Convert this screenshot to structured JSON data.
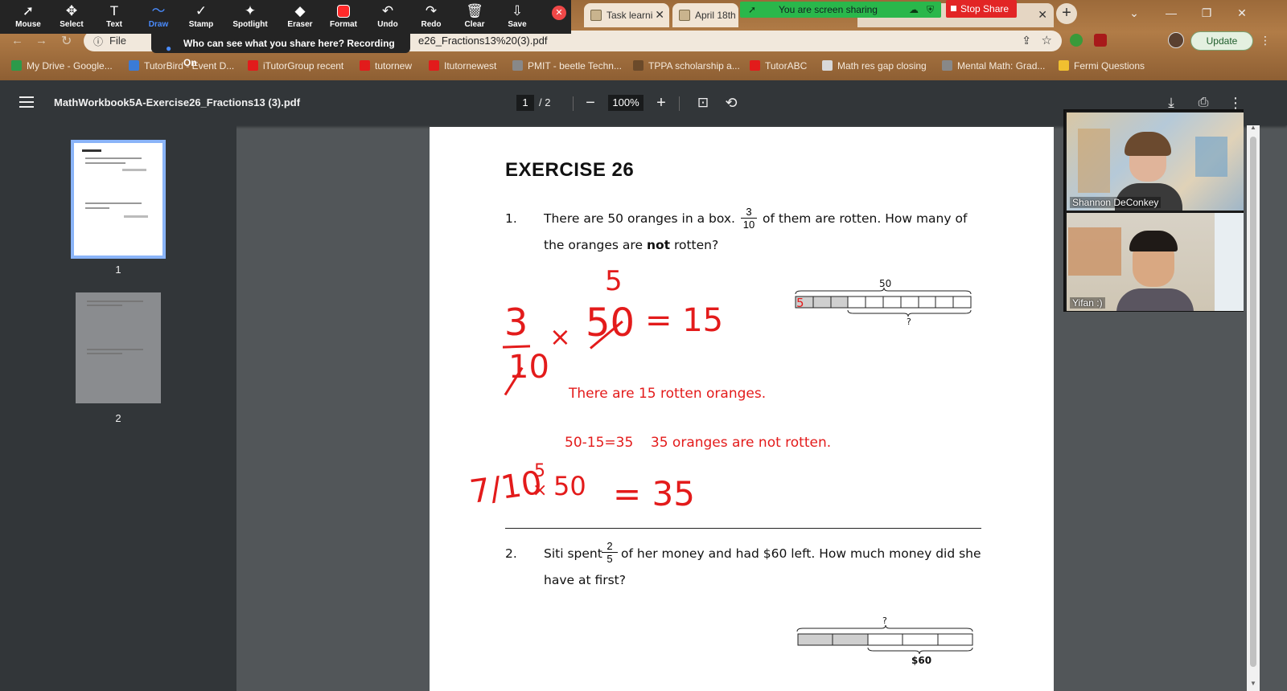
{
  "zoom_toolbar": {
    "tools": [
      {
        "label": "Mouse",
        "icon": "mouse-pointer-icon",
        "glyph": "➚"
      },
      {
        "label": "Select",
        "icon": "move-icon",
        "glyph": "✥"
      },
      {
        "label": "Text",
        "icon": "text-icon",
        "glyph": "T"
      },
      {
        "label": "Draw",
        "icon": "draw-icon",
        "glyph": "〜"
      },
      {
        "label": "Stamp",
        "icon": "stamp-icon",
        "glyph": "✓"
      },
      {
        "label": "Spotlight",
        "icon": "spotlight-icon",
        "glyph": "✦"
      },
      {
        "label": "Eraser",
        "icon": "eraser-icon",
        "glyph": "◆"
      },
      {
        "label": "Format",
        "icon": "format-icon",
        "glyph": ""
      },
      {
        "label": "Undo",
        "icon": "undo-icon",
        "glyph": "↶"
      },
      {
        "label": "Redo",
        "icon": "redo-icon",
        "glyph": "↷"
      },
      {
        "label": "Clear",
        "icon": "trash-icon",
        "glyph": "🗑"
      },
      {
        "label": "Save",
        "icon": "save-icon",
        "glyph": "⇩"
      }
    ],
    "active_tool": "Draw",
    "format_color": "#ff2a2a",
    "share_notice": "Who can see what you share here? Recording On",
    "sharing_status": "You are screen sharing",
    "stop_share": "Stop Share"
  },
  "browser": {
    "tabs": [
      {
        "title": "Task learni"
      },
      {
        "title": "April 18th"
      }
    ],
    "address_prefix": "File",
    "address": "e26_Fractions13%20(3).pdf",
    "update_label": "Update",
    "bookmarks": [
      {
        "label": "My Drive - Google...",
        "color": "#2d9a4a"
      },
      {
        "label": "TutorBird - Event D...",
        "color": "#3b7bd6"
      },
      {
        "label": "iTutorGroup recent",
        "color": "#e21b1b"
      },
      {
        "label": "tutornew",
        "color": "#e21b1b"
      },
      {
        "label": "Itutornewest",
        "color": "#e21b1b"
      },
      {
        "label": "PMIT - beetle Techn...",
        "color": "#888888"
      },
      {
        "label": "TPPA scholarship a...",
        "color": "#6b4a2a"
      },
      {
        "label": "TutorABC",
        "color": "#e21b1b"
      },
      {
        "label": "Math res gap closing",
        "color": "#d8d8d8"
      },
      {
        "label": "Mental Math: Grad...",
        "color": "#888888"
      },
      {
        "label": "Fermi Questions",
        "color": "#f0c030"
      }
    ]
  },
  "pdf": {
    "title": "MathWorkbook5A-Exercise26_Fractions13 (3).pdf",
    "current_page": "1",
    "total_pages": "/ 2",
    "zoom": "100%",
    "thumbnail_labels": [
      "1",
      "2"
    ]
  },
  "document": {
    "heading": "EXERCISE 26",
    "q1": {
      "number": "1.",
      "text_before": "There are 50 oranges in a box.",
      "frac_num": "3",
      "frac_den": "10",
      "text_after": "of them are rotten. How many of",
      "line2_before": "the oranges are",
      "line2_bold": "not",
      "line2_after": "rotten?",
      "model_total": "50",
      "model_unknown": "?"
    },
    "q2": {
      "number": "2.",
      "text_before": "Siti spent",
      "frac_num": "2",
      "frac_den": "5",
      "text_after": "of her money and had $60 left. How much money did she",
      "line2": "have at first?",
      "model_unknown": "?",
      "model_left": "$60"
    },
    "annotations": {
      "hand1_num": "3",
      "hand1_den": "10",
      "hand1_times": "×",
      "hand1_value": "50",
      "hand1_cancel": "5",
      "hand1_result": "= 15",
      "bar_mark": "5",
      "typed1": "There are 15 rotten oranges.",
      "typed2": "50-15=35    35 oranges are not rotten.",
      "hand2_frac": "7/10",
      "hand2_small": "5",
      "hand2_times": "×",
      "hand2_value": "50",
      "hand2_result": "= 35"
    }
  },
  "participants": [
    {
      "name": "Shannon DeConkey"
    },
    {
      "name": "Yifan :)"
    }
  ]
}
